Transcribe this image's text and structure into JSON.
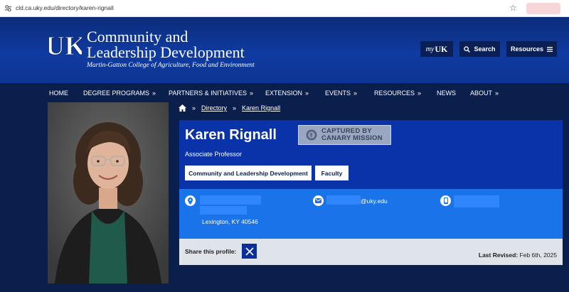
{
  "browser": {
    "url": "cld.ca.uky.edu/directory/karen-rignall",
    "icons": [
      "site-info-icon",
      "bookmark-star-icon"
    ]
  },
  "header": {
    "logo_text": "UK",
    "title_line1": "Community and",
    "title_line2": "Leadership Development",
    "college": "Martin-Gatton College of Agriculture, Food and Environment",
    "buttons": {
      "myuk_prefix": "my",
      "myuk_logo": "UK",
      "search": "Search",
      "resources": "Resources"
    },
    "colors": {
      "primary": "#0b33a9",
      "dark": "#0a1f4c"
    }
  },
  "nav": {
    "items": [
      {
        "label": "HOME",
        "chevron": false
      },
      {
        "label": "DEGREE PROGRAMS",
        "chevron": true
      },
      {
        "label": "PARTNERS & INITIATIVES",
        "chevron": true
      },
      {
        "label": "EXTENSION",
        "chevron": true
      },
      {
        "label": "EVENTS",
        "chevron": true
      },
      {
        "label": "RESOURCES",
        "chevron": true
      },
      {
        "label": "NEWS",
        "chevron": false
      },
      {
        "label": "ABOUT",
        "chevron": true
      }
    ],
    "chevron_glyph": "»"
  },
  "breadcrumb": {
    "sep": "»",
    "items": [
      "Directory",
      "Karen Rignall"
    ]
  },
  "profile": {
    "name": "Karen Rignall",
    "stamp_line1": "CAPTURED BY",
    "stamp_line2": "CANARY MISSION",
    "role": "Associate Professor",
    "tags": [
      "Community and Leadership Development",
      "Faculty"
    ],
    "address_city": "Lexington, KY 40546",
    "email_suffix": "@uky.edu",
    "share_label": "Share this profile:",
    "revised_label": "Last Revised:",
    "revised_date": "Feb 6th, 2025"
  }
}
